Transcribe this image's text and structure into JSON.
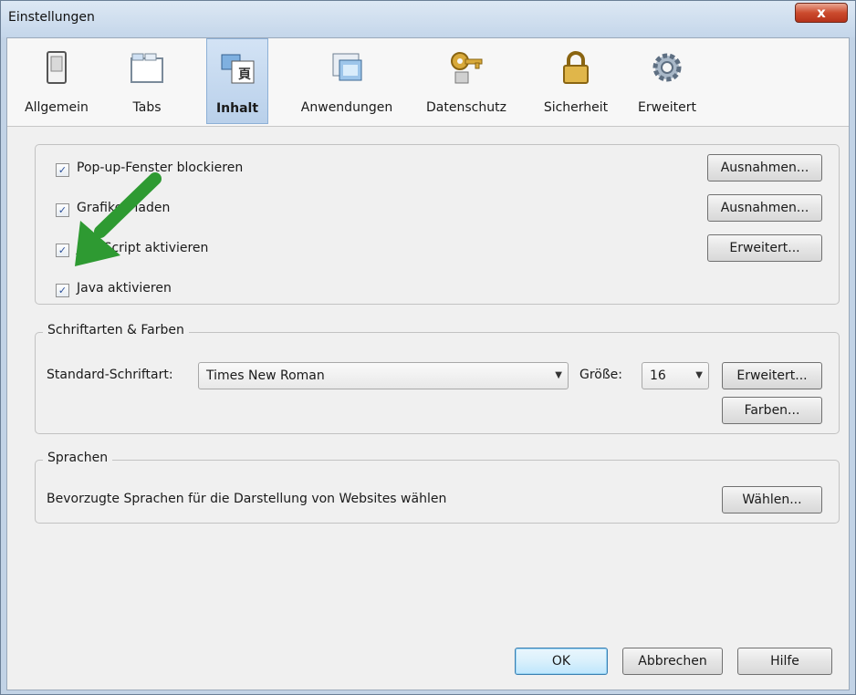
{
  "window": {
    "title": "Einstellungen",
    "close_label": "x"
  },
  "toolbar": {
    "items": [
      {
        "label": "Allgemein",
        "icon": "switch-icon"
      },
      {
        "label": "Tabs",
        "icon": "tabs-icon"
      },
      {
        "label": "Inhalt",
        "icon": "content-icon",
        "selected": true
      },
      {
        "label": "Anwendungen",
        "icon": "applications-icon"
      },
      {
        "label": "Datenschutz",
        "icon": "key-icon"
      },
      {
        "label": "Sicherheit",
        "icon": "lock-icon"
      },
      {
        "label": "Erweitert",
        "icon": "gear-icon"
      }
    ]
  },
  "content": {
    "checkboxes": [
      {
        "label": "Pop-up-Fenster blockieren",
        "checked": true,
        "button": "Ausnahmen..."
      },
      {
        "label": "Grafiken laden",
        "checked": true,
        "button": "Ausnahmen..."
      },
      {
        "label": "JavaScript aktivieren",
        "checked": true,
        "button": "Erweitert..."
      },
      {
        "label": "Java aktivieren",
        "checked": true
      }
    ]
  },
  "fonts": {
    "legend": "Schriftarten & Farben",
    "default_font_label": "Standard-Schriftart:",
    "default_font_value": "Times New Roman",
    "size_label": "Größe:",
    "size_value": "16",
    "advanced_button": "Erweitert...",
    "colors_button": "Farben..."
  },
  "languages": {
    "legend": "Sprachen",
    "description": "Bevorzugte Sprachen für die Darstellung von Websites wählen",
    "choose_button": "Wählen..."
  },
  "footer": {
    "ok": "OK",
    "cancel": "Abbrechen",
    "help": "Hilfe"
  },
  "colors": {
    "arrow": "#2e9a32",
    "selected_tab": "#c6daf0",
    "titlebar": "#cfdeef"
  }
}
